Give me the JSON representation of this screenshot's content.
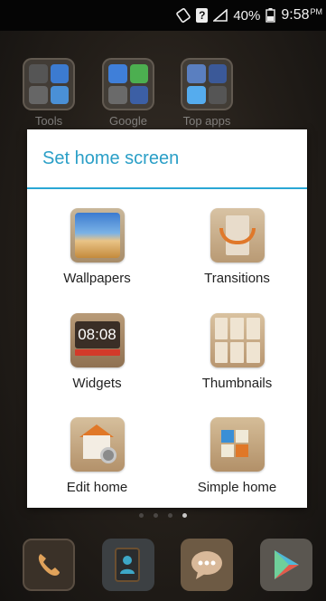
{
  "status_bar": {
    "battery": "40%",
    "time": "9:58",
    "ampm": "PM",
    "icons": [
      "rotation-lock-icon",
      "question-sim-icon",
      "signal-icon",
      "battery-icon"
    ]
  },
  "home_folders": [
    {
      "label": "Tools"
    },
    {
      "label": "Google"
    },
    {
      "label": "Top apps"
    }
  ],
  "dialog": {
    "title": "Set home screen",
    "options": [
      {
        "label": "Wallpapers",
        "icon": "wallpapers-icon"
      },
      {
        "label": "Transitions",
        "icon": "transitions-icon"
      },
      {
        "label": "Widgets",
        "icon": "widgets-icon",
        "clock_text": "08:08"
      },
      {
        "label": "Thumbnails",
        "icon": "thumbnails-icon"
      },
      {
        "label": "Edit home",
        "icon": "edit-home-icon"
      },
      {
        "label": "Simple home",
        "icon": "simple-home-icon"
      }
    ]
  },
  "page_indicator": {
    "count": 4,
    "active_index": 3
  },
  "dock": [
    {
      "icon": "phone-icon"
    },
    {
      "icon": "contacts-icon"
    },
    {
      "icon": "messages-icon"
    },
    {
      "icon": "play-store-icon"
    }
  ],
  "colors": {
    "accent": "#2a9fc7",
    "status_bar_bg": "#050505",
    "dialog_bg": "#ffffff"
  }
}
